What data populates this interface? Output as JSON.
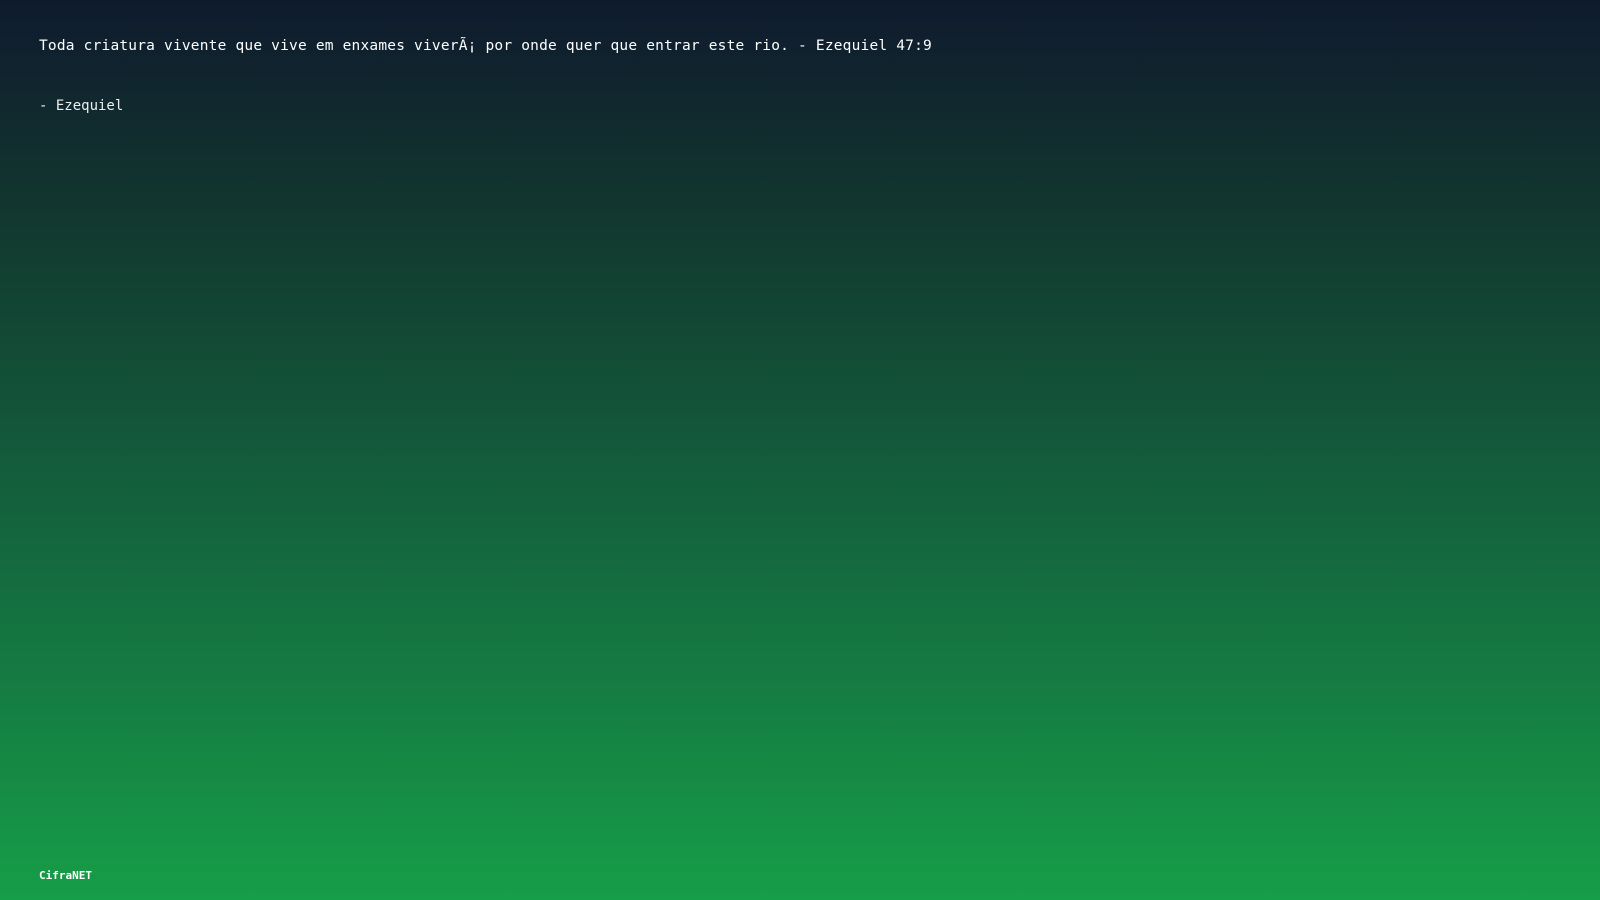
{
  "quote": {
    "text": "Toda criatura vivente que vive em enxames viverÃ¡ por onde quer que entrar este rio. - Ezequiel 47:9",
    "author": "- Ezequiel"
  },
  "footer": {
    "brand": "CifraNET"
  },
  "colors": {
    "gradient_top": "#0f1a2e",
    "gradient_bottom": "#169e48",
    "text": "#ffffff"
  }
}
